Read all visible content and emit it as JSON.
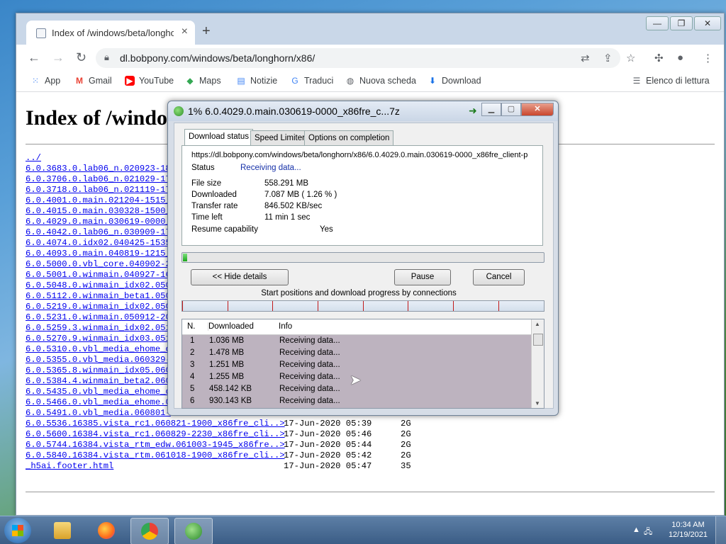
{
  "browser": {
    "tab_title": "Index of /windows/beta/longhorn",
    "url": "dl.bobpony.com/windows/beta/longhorn/x86/",
    "bookmarks": [
      {
        "label": "App",
        "icon": "apps-grid-icon"
      },
      {
        "label": "Gmail",
        "icon": "gmail-icon"
      },
      {
        "label": "YouTube",
        "icon": "youtube-icon"
      },
      {
        "label": "Maps",
        "icon": "maps-icon"
      },
      {
        "label": "Notizie",
        "icon": "news-icon"
      },
      {
        "label": "Traduci",
        "icon": "translate-icon"
      },
      {
        "label": "Nuova scheda",
        "icon": "globe-icon"
      },
      {
        "label": "Download",
        "icon": "download-icon"
      }
    ],
    "reading_list": "Elenco di lettura"
  },
  "page": {
    "heading": "Index of /windows/beta/longhorn/x86/",
    "rows": [
      {
        "name": "../",
        "date": "",
        "size": ""
      },
      {
        "name": "6.0.3683.0.lab06_n.020923-18",
        "date": "",
        "size": ""
      },
      {
        "name": "6.0.3706.0.lab06_n.021029-17",
        "date": "",
        "size": ""
      },
      {
        "name": "6.0.3718.0.lab06_n.021119-17",
        "date": "",
        "size": ""
      },
      {
        "name": "6.0.4001.0.main.021204-1515_",
        "date": "",
        "size": ""
      },
      {
        "name": "6.0.4015.0.main.030328-1500_",
        "date": "",
        "size": ""
      },
      {
        "name": "6.0.4029.0.main.030619-0000_",
        "date": "",
        "size": ""
      },
      {
        "name": "6.0.4042.0.lab06_n.030909-17",
        "date": "",
        "size": ""
      },
      {
        "name": "6.0.4074.0.idx02.040425-1535",
        "date": "",
        "size": ""
      },
      {
        "name": "6.0.4093.0.main.040819-1215_",
        "date": "",
        "size": ""
      },
      {
        "name": "6.0.5000.0.vbl_core.040902-2",
        "date": "",
        "size": ""
      },
      {
        "name": "6.0.5001.0.winmain.040927-16",
        "date": "",
        "size": ""
      },
      {
        "name": "6.0.5048.0.winmain_idx02.050",
        "date": "",
        "size": ""
      },
      {
        "name": "6.0.5112.0.winmain_beta1.050",
        "date": "",
        "size": ""
      },
      {
        "name": "6.0.5219.0.winmain_idx02.050",
        "date": "",
        "size": ""
      },
      {
        "name": "6.0.5231.0.winmain.050912-20",
        "date": "",
        "size": ""
      },
      {
        "name": "6.0.5259.3.winmain_idx02.051",
        "date": "",
        "size": ""
      },
      {
        "name": "6.0.5270.9.winmain_idx03.051",
        "date": "",
        "size": ""
      },
      {
        "name": "6.0.5310.0.vbl_media_ehome_d",
        "date": "",
        "size": ""
      },
      {
        "name": "6.0.5355.0.vbl_media.060329-",
        "date": "",
        "size": ""
      },
      {
        "name": "6.0.5365.8.winmain_idx05.060",
        "date": "",
        "size": ""
      },
      {
        "name": "6.0.5384.4.winmain_beta2.060",
        "date": "",
        "size": ""
      },
      {
        "name": "6.0.5435.0.vbl_media_ehome_d",
        "date": "",
        "size": ""
      },
      {
        "name": "6.0.5466.0.vbl_media_ehome.0",
        "date": "",
        "size": ""
      },
      {
        "name": "6.0.5491.0.vbl_media.060801-",
        "date": "",
        "size": ""
      },
      {
        "name": "6.0.5536.16385.vista_rc1.060821-1900_x86fre_cli..>",
        "date": "17-Jun-2020 05:39",
        "size": "2G"
      },
      {
        "name": "6.0.5600.16384.vista_rc1.060829-2230_x86fre_cli..>",
        "date": "17-Jun-2020 05:46",
        "size": "2G"
      },
      {
        "name": "6.0.5744.16384.vista_rtm_edw.061003-1945_x86fre..>",
        "date": "17-Jun-2020 05:44",
        "size": "2G"
      },
      {
        "name": "6.0.5840.16384.vista_rtm.061018-1900_x86fre_cli..>",
        "date": "17-Jun-2020 05:42",
        "size": "2G"
      },
      {
        "name": "_h5ai.footer.html",
        "date": "17-Jun-2020 05:47",
        "size": "35"
      }
    ]
  },
  "idm": {
    "title": "1% 6.0.4029.0.main.030619-0000_x86fre_c...7z",
    "tabs": [
      "Download status",
      "Speed Limiter",
      "Options on completion"
    ],
    "url": "https://dl.bobpony.com/windows/beta/longhorn/x86/6.0.4029.0.main.030619-0000_x86fre_client-p",
    "status_label": "Status",
    "status_value": "Receiving data...",
    "file_size_label": "File size",
    "file_size": "558.291  MB",
    "downloaded_label": "Downloaded",
    "downloaded": "7.087  MB  ( 1.26 % )",
    "rate_label": "Transfer rate",
    "rate": "846.502  KB/sec",
    "time_left_label": "Time left",
    "time_left": "11 min 1 sec",
    "resume_label": "Resume capability",
    "resume": "Yes",
    "progress": 0.0126,
    "hide_details": "<< Hide details",
    "pause": "Pause",
    "cancel": "Cancel",
    "connections_caption": "Start positions and download progress by connections",
    "grid_headers": [
      "N.",
      "Downloaded",
      "Info"
    ],
    "connections": [
      {
        "n": "1",
        "downloaded": "1.036  MB",
        "info": "Receiving data..."
      },
      {
        "n": "2",
        "downloaded": "1.478  MB",
        "info": "Receiving data..."
      },
      {
        "n": "3",
        "downloaded": "1.251  MB",
        "info": "Receiving data..."
      },
      {
        "n": "4",
        "downloaded": "1.255  MB",
        "info": "Receiving data..."
      },
      {
        "n": "5",
        "downloaded": "458.142  KB",
        "info": "Receiving data..."
      },
      {
        "n": "6",
        "downloaded": "930.143  KB",
        "info": "Receiving data..."
      }
    ]
  },
  "taskbar": {
    "apps": [
      "file-explorer-icon",
      "firefox-icon",
      "chrome-icon",
      "idm-icon"
    ],
    "time": "10:34 AM",
    "date": "12/19/2021"
  }
}
